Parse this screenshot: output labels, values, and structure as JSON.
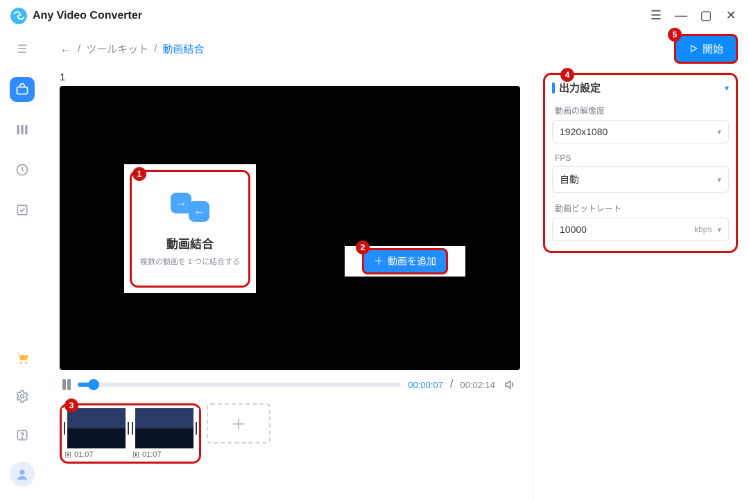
{
  "app": {
    "title": "Any Video Converter"
  },
  "breadcrumb": {
    "parent": "ツールキット",
    "current": "動画結合",
    "sep": "/"
  },
  "start_button": "開始",
  "video": {
    "label": "1"
  },
  "feature_card": {
    "title": "動画結合",
    "subtitle": "複数の動画を 1 つに結合する",
    "icon_a": "→",
    "icon_b": "←"
  },
  "add_video_button": "動画を追加",
  "player": {
    "current": "00:00:07",
    "total": "00:02:14",
    "sep": "/"
  },
  "clips": [
    {
      "duration": "01:07"
    },
    {
      "duration": "01:07"
    }
  ],
  "output_settings": {
    "title": "出力設定",
    "fields": {
      "resolution": {
        "label": "動画の解像度",
        "value": "1920x1080"
      },
      "fps": {
        "label": "FPS",
        "value": "自動"
      },
      "bitrate": {
        "label": "動画ビットレート",
        "value": "10000",
        "unit": "kbps"
      }
    }
  },
  "annotations": {
    "a1": "1",
    "a2": "2",
    "a3": "3",
    "a4": "4",
    "a5": "5"
  }
}
